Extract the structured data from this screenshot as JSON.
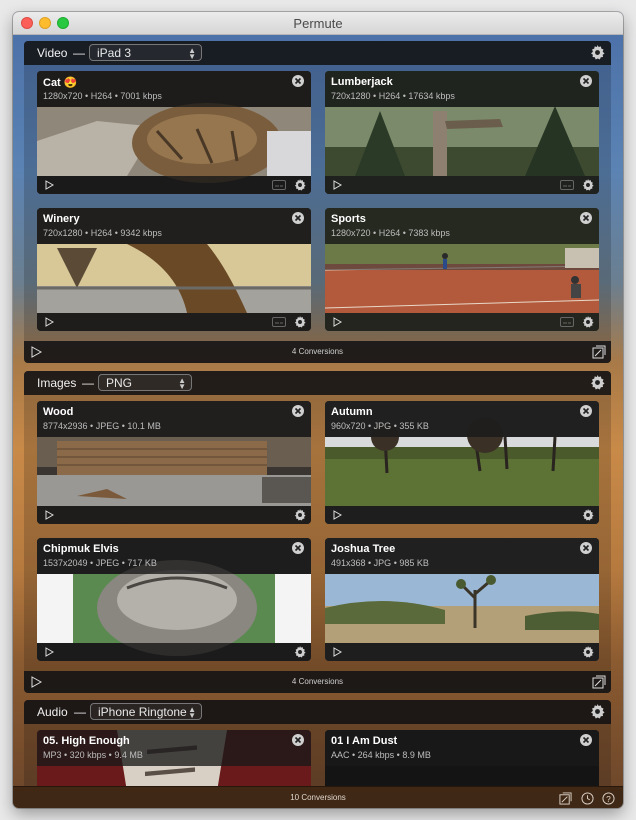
{
  "window": {
    "title": "Permute"
  },
  "sections": [
    {
      "title": "Video",
      "preset": "iPad 3",
      "footer": "4 Conversions",
      "cards": [
        {
          "name": "Cat 😍",
          "meta": "1280x720 • H264 • 7001 kbps"
        },
        {
          "name": "Lumberjack",
          "meta": "720x1280 • H264 • 17634 kbps"
        },
        {
          "name": "Winery",
          "meta": "720x1280 • H264 • 9342 kbps"
        },
        {
          "name": "Sports",
          "meta": "1280x720 • H264 • 7383 kbps"
        }
      ]
    },
    {
      "title": "Images",
      "preset": "PNG",
      "footer": "4 Conversions",
      "cards": [
        {
          "name": "Wood",
          "meta": "8774x2936 • JPEG • 10.1 MB"
        },
        {
          "name": "Autumn",
          "meta": "960x720 • JPG • 355 KB"
        },
        {
          "name": "Chipmuk Elvis",
          "meta": "1537x2049 • JPEG • 717 KB"
        },
        {
          "name": "Joshua Tree",
          "meta": "491x368 • JPG • 985 KB"
        }
      ]
    },
    {
      "title": "Audio",
      "preset": "iPhone Ringtone",
      "cards": [
        {
          "name": "05. High Enough",
          "meta": "MP3 • 320 kbps • 9.4 MB"
        },
        {
          "name": "01 I Am Dust",
          "meta": "AAC • 264 kbps • 8.9 MB"
        }
      ]
    }
  ],
  "bottom_bar": {
    "text": "10 Conversions"
  },
  "dash": "—"
}
